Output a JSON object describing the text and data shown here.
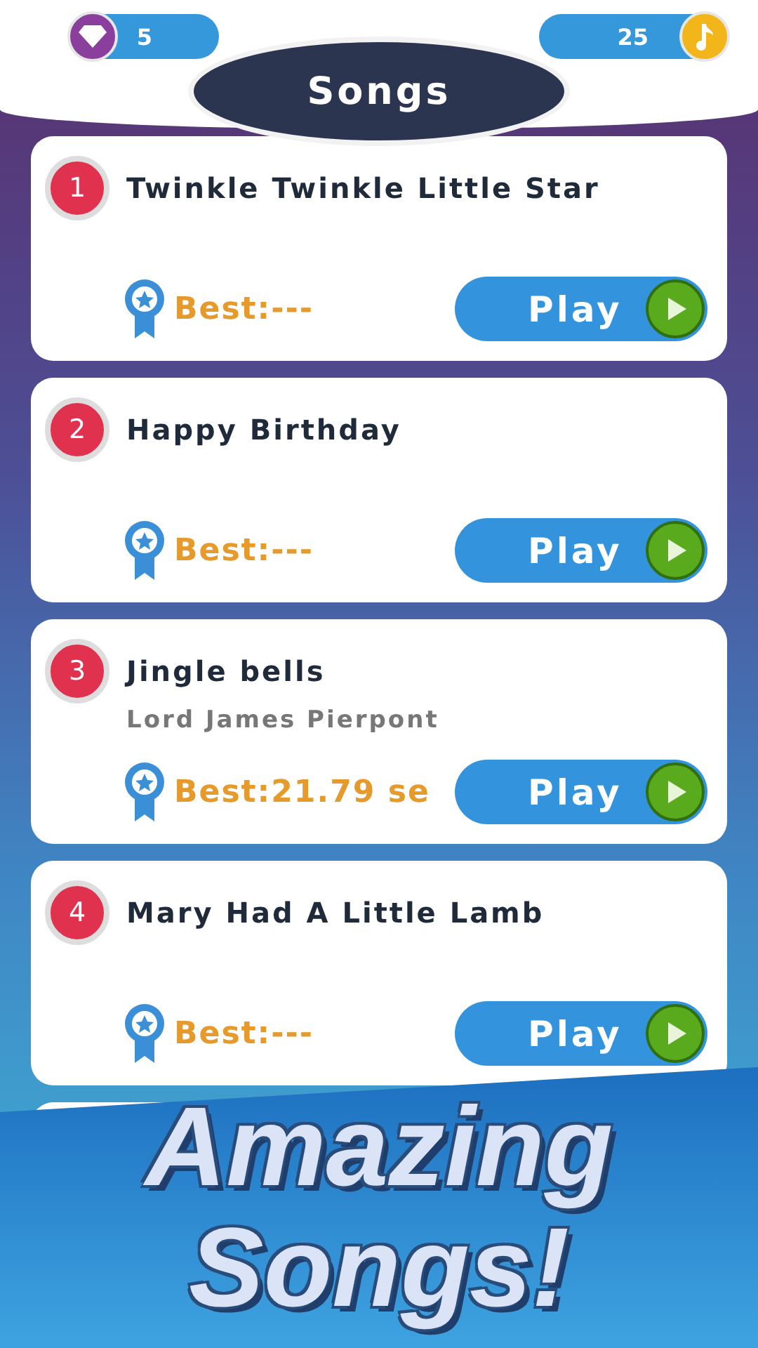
{
  "currency": {
    "gems": "5",
    "notes": "25"
  },
  "title": "Songs",
  "songs": [
    {
      "number": "1",
      "name": "Twinkle Twinkle Little Star",
      "best": "Best:---",
      "button": "Play"
    },
    {
      "number": "2",
      "name": "Happy Birthday",
      "best": "Best:---",
      "button": "Play"
    },
    {
      "number": "3",
      "name": "Jingle bells",
      "artist": "Lord James Pierpont",
      "best": "Best:21.79 se",
      "button": "Play"
    },
    {
      "number": "4",
      "name": "Mary Had A Little Lamb",
      "best": "Best:---",
      "button": "Play"
    }
  ],
  "banner": {
    "lines": [
      "Amazing",
      "Songs!"
    ]
  }
}
